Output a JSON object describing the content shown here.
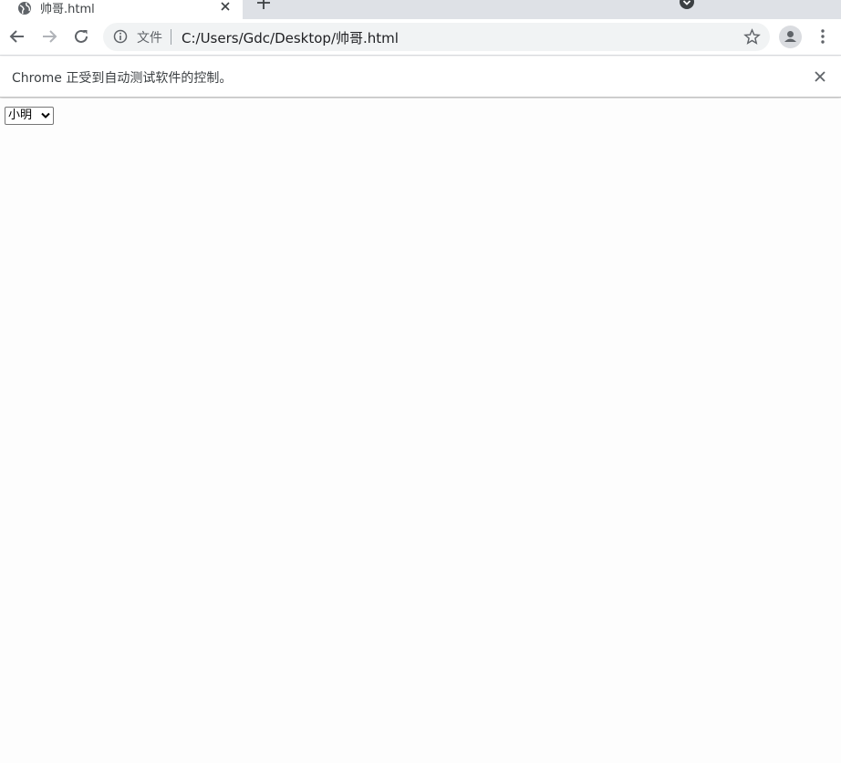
{
  "browser": {
    "tab": {
      "title": "帅哥.html",
      "favicon_icon": "globe-icon",
      "close_icon": "close-icon"
    },
    "new_tab_icon": "plus-icon",
    "tab_search_icon": "chevron-down-circle-icon",
    "toolbar": {
      "back_icon": "arrow-left-icon",
      "forward_icon": "arrow-right-icon",
      "reload_icon": "reload-icon",
      "site_info_icon": "info-icon",
      "scheme_label": "文件",
      "url": "C:/Users/Gdc/Desktop/帅哥.html",
      "bookmark_icon": "star-icon",
      "profile_icon": "person-icon",
      "menu_icon": "kebab-menu-icon"
    },
    "infobar": {
      "message": "Chrome 正受到自动测试软件的控制。",
      "close_icon": "close-icon"
    }
  },
  "page": {
    "select": {
      "selected_value": "小明"
    }
  },
  "colors": {
    "tabstrip_bg": "#dee1e6",
    "omnibox_bg": "#f1f3f4",
    "icon_color": "#5f6368",
    "page_bg": "#fdfdfd"
  }
}
